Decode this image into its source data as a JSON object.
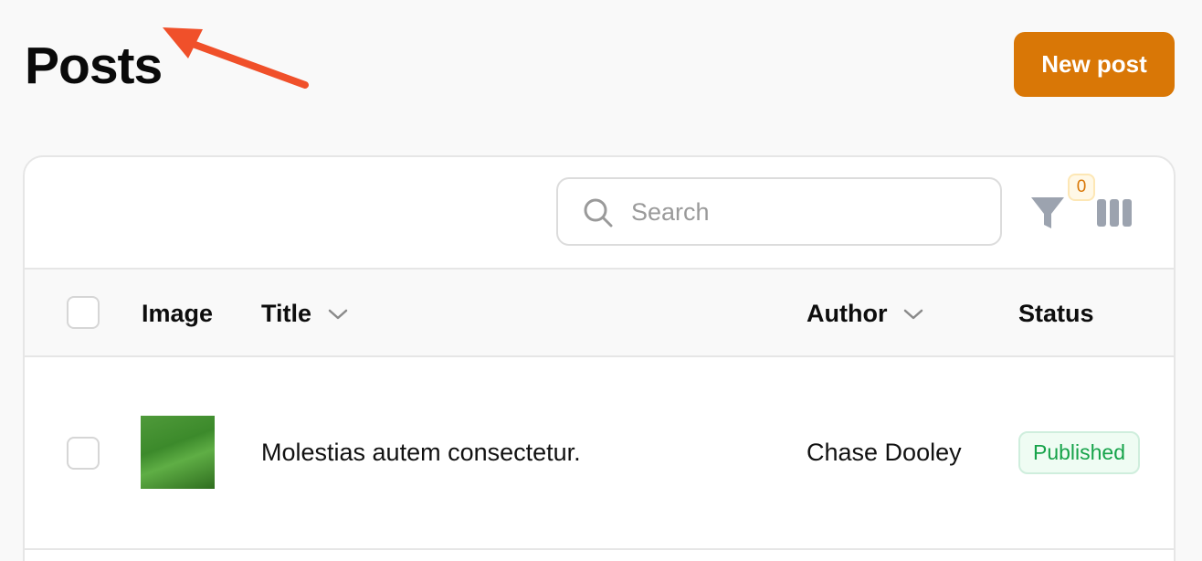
{
  "header": {
    "title": "Posts",
    "new_post_label": "New post"
  },
  "toolbar": {
    "search_placeholder": "Search",
    "filter_count": "0"
  },
  "table": {
    "columns": {
      "image": "Image",
      "title": "Title",
      "author": "Author",
      "status": "Status"
    },
    "rows": [
      {
        "title": "Molestias autem consectetur.",
        "author": "Chase Dooley",
        "status": "Published"
      }
    ]
  },
  "colors": {
    "accent": "#d97706",
    "annotation_arrow": "#f0502a",
    "status_published": "#16a34a"
  }
}
